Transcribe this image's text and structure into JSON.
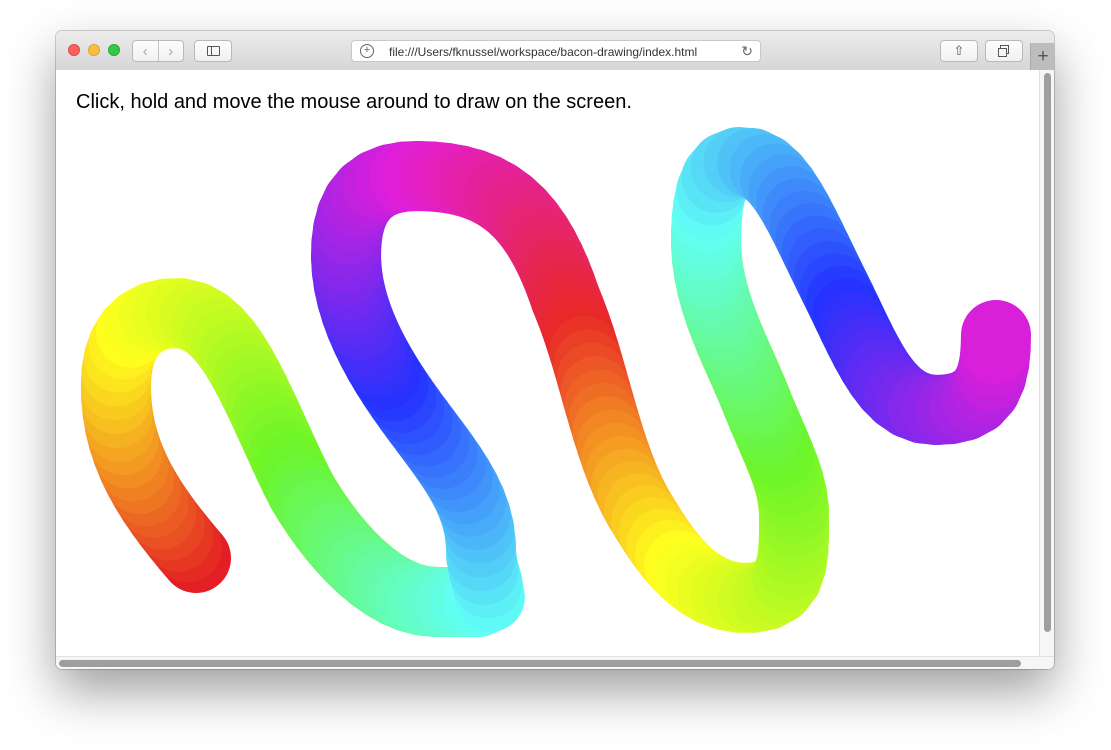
{
  "browser": {
    "url": "file:///Users/fknussel/workspace/bacon-drawing/index.html",
    "back_icon": "chevron-left-icon",
    "forward_icon": "chevron-right-icon",
    "reload_icon": "reload-icon",
    "new_tab_label": "+"
  },
  "page": {
    "instruction": "Click, hold and move the mouse around to draw on the screen."
  },
  "drawing": {
    "stroke_color_sequence": [
      "#e31e24",
      "#ffff1e",
      "#6cf528",
      "#61fff5",
      "#2432ff",
      "#e21ed8",
      "#e82828",
      "#ffff1e",
      "#6cf528",
      "#61fff5",
      "#2432ff",
      "#e21ed8"
    ]
  }
}
